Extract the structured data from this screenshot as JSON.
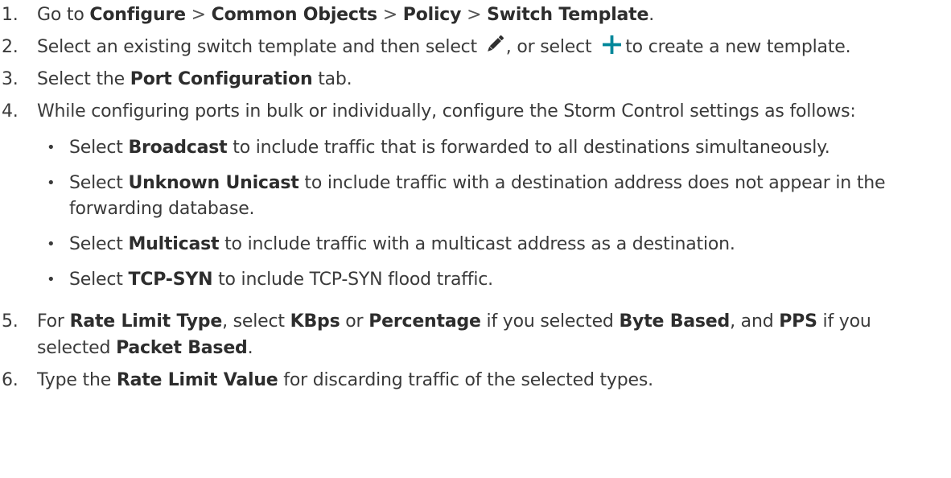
{
  "steps": [
    {
      "num": "1.",
      "t1": "Go to ",
      "b1": "Configure",
      "s1": " > ",
      "b2": "Common Objects",
      "s2": " > ",
      "b3": "Policy",
      "s3": " > ",
      "b4": "Switch Template",
      "t2": "."
    },
    {
      "num": "2.",
      "t1": "Select an existing switch template and then select ",
      "icon1": "pencil-icon",
      "t2": ", or select ",
      "icon2": "plus-icon",
      "t3": "to create a new template."
    },
    {
      "num": "3.",
      "t1": "Select the ",
      "b1": "Port Configuration",
      "t2": " tab."
    },
    {
      "num": "4.",
      "t1": "While configuring ports in bulk or individually, configure the Storm Control settings as follows:",
      "bullets": [
        {
          "dot": "•",
          "t1": "Select ",
          "b1": "Broadcast",
          "t2": " to include traffic that is forwarded to all destinations simultaneously."
        },
        {
          "dot": "•",
          "t1": "Select ",
          "b1": "Unknown Unicast",
          "t2": " to include traffic with a destination address does not appear in the forwarding database."
        },
        {
          "dot": "•",
          "t1": "Select ",
          "b1": "Multicast",
          "t2": " to include traffic with a multicast address as a destination."
        },
        {
          "dot": "•",
          "t1": "Select ",
          "b1": "TCP-SYN",
          "t2": " to include TCP-SYN flood traffic."
        }
      ]
    },
    {
      "num": "5.",
      "t1": "For ",
      "b1": "Rate Limit Type",
      "t2": ", select ",
      "b2": "KBps",
      "t3": " or ",
      "b3": "Percentage",
      "t4": " if you selected ",
      "b4": "Byte Based",
      "t5": ", and ",
      "b5": "PPS",
      "t6": " if you selected ",
      "b6": "Packet Based",
      "t7": "."
    },
    {
      "num": "6.",
      "t1": "Type the ",
      "b1": "Rate Limit Value",
      "t2": " for discarding traffic of the selected types."
    }
  ],
  "colors": {
    "text": "#3a3a3a",
    "pencil_icon": "#2f2f2f",
    "plus_icon": "#00879a"
  }
}
